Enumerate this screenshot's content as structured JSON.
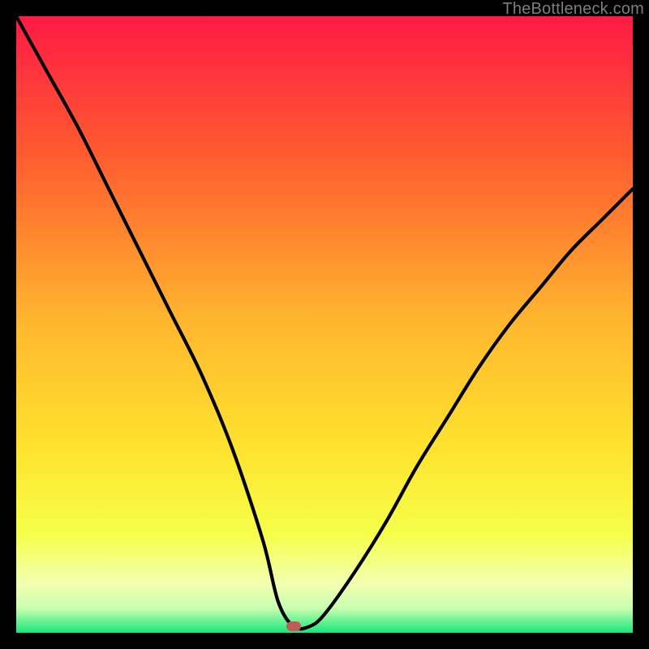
{
  "watermark": {
    "text": "TheBottleneck.com"
  },
  "colors": {
    "bg": "#000000",
    "top": "#ff1a45",
    "upper_mid": "#ff7a2e",
    "mid": "#ffd62e",
    "lower_mid": "#f6ff4a",
    "pale": "#f6ffb8",
    "green": "#17e67a",
    "curve": "#000000",
    "marker": "#c05a5a"
  },
  "chart_data": {
    "type": "line",
    "title": "",
    "xlabel": "",
    "ylabel": "",
    "xlim": [
      0,
      100
    ],
    "ylim": [
      0,
      100
    ],
    "grid": false,
    "legend": false,
    "description": "Single V-shaped bottleneck curve on a vertical red→yellow→green gradient; minimum marked with a pink pill near x≈45.",
    "series": [
      {
        "name": "bottleneck-curve",
        "x": [
          0,
          5,
          10,
          15,
          20,
          25,
          30,
          35,
          40,
          42.5,
          45,
          47.5,
          50,
          55,
          60,
          65,
          70,
          75,
          80,
          85,
          90,
          95,
          100
        ],
        "values": [
          100,
          91,
          82,
          72,
          62,
          52,
          42,
          30,
          15,
          5,
          1,
          1,
          3,
          10,
          18,
          27,
          35,
          43,
          50,
          56,
          62,
          67,
          72
        ]
      }
    ],
    "marker": {
      "x": 45,
      "y": 1
    },
    "gradient_stops": [
      {
        "pct": 0,
        "color": "#ff1a45"
      },
      {
        "pct": 22,
        "color": "#ff5a30"
      },
      {
        "pct": 50,
        "color": "#ffb82e"
      },
      {
        "pct": 70,
        "color": "#ffe22e"
      },
      {
        "pct": 84,
        "color": "#f6ff4a"
      },
      {
        "pct": 92,
        "color": "#f2ffb0"
      },
      {
        "pct": 96,
        "color": "#c9ffb0"
      },
      {
        "pct": 100,
        "color": "#17e67a"
      }
    ]
  }
}
